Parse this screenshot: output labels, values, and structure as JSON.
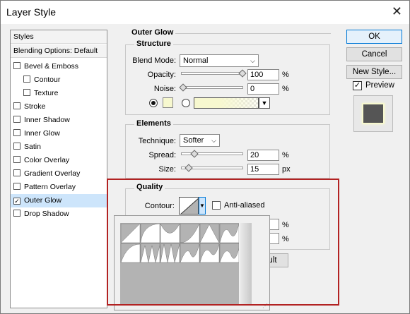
{
  "window": {
    "title": "Layer Style",
    "close_glyph": "✕"
  },
  "styles_list": {
    "header": "Styles",
    "blending": "Blending Options: Default",
    "items": [
      {
        "label": "Bevel & Emboss",
        "checked": false,
        "indent": false
      },
      {
        "label": "Contour",
        "checked": false,
        "indent": true
      },
      {
        "label": "Texture",
        "checked": false,
        "indent": true
      },
      {
        "label": "Stroke",
        "checked": false,
        "indent": false
      },
      {
        "label": "Inner Shadow",
        "checked": false,
        "indent": false
      },
      {
        "label": "Inner Glow",
        "checked": false,
        "indent": false
      },
      {
        "label": "Satin",
        "checked": false,
        "indent": false
      },
      {
        "label": "Color Overlay",
        "checked": false,
        "indent": false
      },
      {
        "label": "Gradient Overlay",
        "checked": false,
        "indent": false
      },
      {
        "label": "Pattern Overlay",
        "checked": false,
        "indent": false
      },
      {
        "label": "Outer Glow",
        "checked": true,
        "indent": false,
        "selected": true
      },
      {
        "label": "Drop Shadow",
        "checked": false,
        "indent": false
      }
    ]
  },
  "outer_glow": {
    "title": "Outer Glow",
    "structure": {
      "title": "Structure",
      "blend_mode_label": "Blend Mode:",
      "blend_mode_value": "Normal",
      "opacity_label": "Opacity:",
      "opacity_value": "100",
      "opacity_unit": "%",
      "noise_label": "Noise:",
      "noise_value": "0",
      "noise_unit": "%",
      "glow_color": "#f7f8cf"
    },
    "elements": {
      "title": "Elements",
      "technique_label": "Technique:",
      "technique_value": "Softer",
      "spread_label": "Spread:",
      "spread_value": "20",
      "spread_unit": "%",
      "size_label": "Size:",
      "size_value": "15",
      "size_unit": "px"
    },
    "quality": {
      "title": "Quality",
      "contour_label": "Contour:",
      "anti_aliased_label": "Anti-aliased",
      "partial_unit_1": "%",
      "partial_unit_2": "%",
      "partial_button": "ult"
    }
  },
  "buttons": {
    "ok": "OK",
    "cancel": "Cancel",
    "new_style": "New Style...",
    "preview_label": "Preview"
  },
  "colors": {
    "highlight": "#b22222",
    "selection": "#cde5fb"
  }
}
